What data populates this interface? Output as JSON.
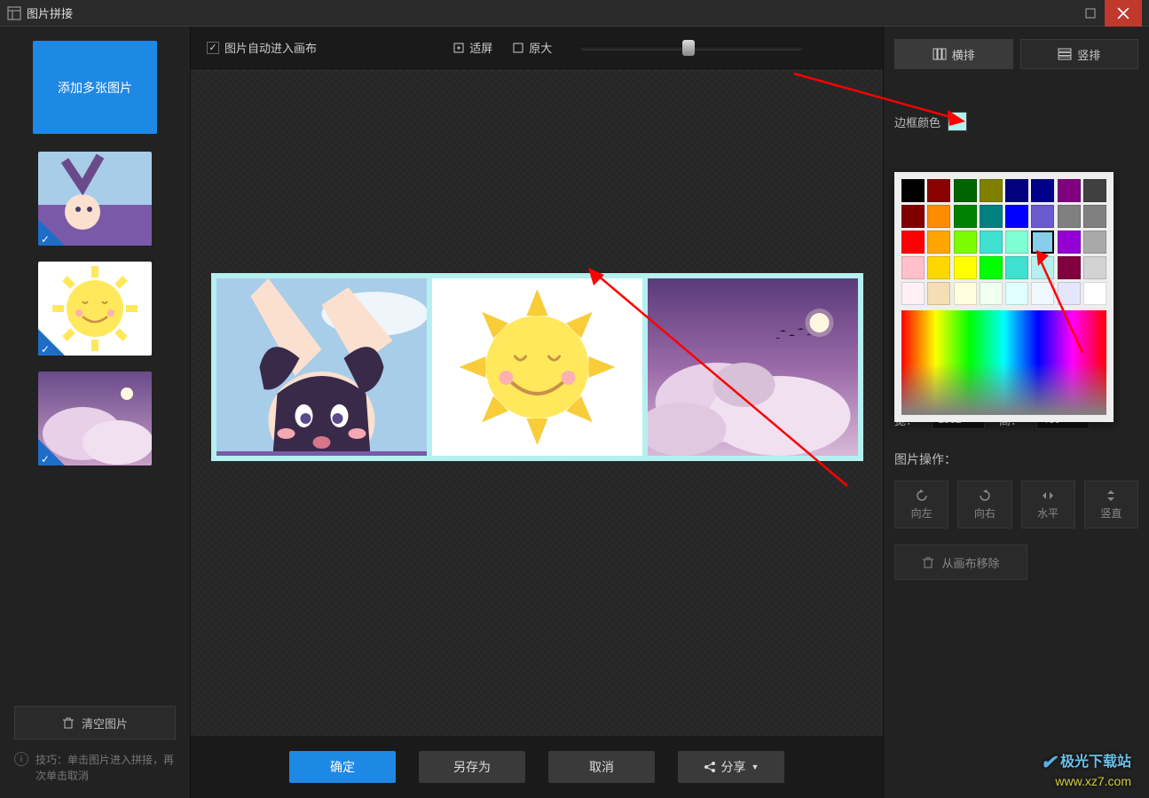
{
  "window": {
    "title": "图片拼接"
  },
  "sidebar": {
    "add_button": "添加多张图片",
    "clear_button": "清空图片",
    "tip_label": "技巧：",
    "tip_text": "单击图片进入拼接，再次单击取消"
  },
  "toolbar": {
    "auto_canvas": "图片自动进入画布",
    "fit_screen": "适屏",
    "original_size": "原大"
  },
  "layout": {
    "horizontal": "横排",
    "vertical": "竖排"
  },
  "border": {
    "label": "边框颜色",
    "chosen_color": "#b5f0f0"
  },
  "size": {
    "width_label": "宽：",
    "width": "1532",
    "height_label": "高：",
    "height": "430"
  },
  "ops": {
    "section": "图片操作：",
    "left": "向左",
    "right": "向右",
    "hflip": "水平",
    "vflip": "竖直",
    "remove": "从画布移除"
  },
  "buttons": {
    "ok": "确定",
    "saveas": "另存为",
    "cancel": "取消",
    "share": "分享"
  },
  "color_picker": {
    "swatches": [
      "#000000",
      "#8b0000",
      "#006400",
      "#808000",
      "#000080",
      "#00008b",
      "#800080",
      "#404040",
      "#800000",
      "#ff8c00",
      "#008000",
      "#008080",
      "#0000ff",
      "#6a5acd",
      "#808080",
      "#808080",
      "#ff0000",
      "#ffa500",
      "#7cfc00",
      "#40e0d0",
      "#7fffd4",
      "#87ceeb",
      "#9400d3",
      "#a9a9a9",
      "#ffc0cb",
      "#ffd700",
      "#ffff00",
      "#00ff00",
      "#40e0d0",
      "#b5f0f0",
      "#800040",
      "#d3d3d3",
      "#fff0f5",
      "#f5deb3",
      "#ffffe0",
      "#f0fff0",
      "#e0ffff",
      "#f0f8ff",
      "#e6e6fa",
      "#ffffff"
    ],
    "selected_index": 21
  },
  "watermark": {
    "zh": "极光下载站",
    "url": "www.xz7.com"
  }
}
